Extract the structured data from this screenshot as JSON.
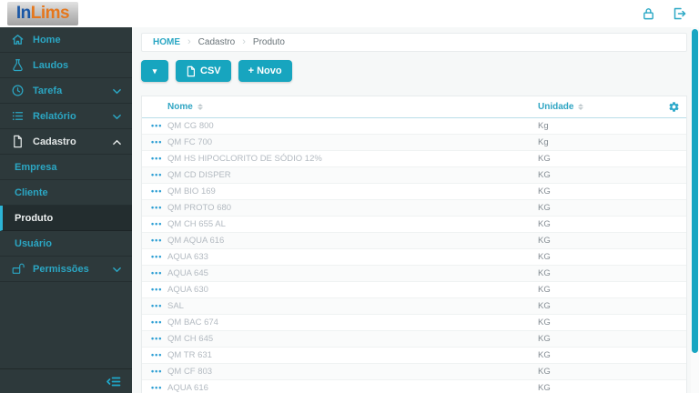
{
  "logo": {
    "part1": "In",
    "part2": "Lims"
  },
  "topbar": {
    "icons": [
      {
        "name": "lock-icon"
      },
      {
        "name": "logout-icon"
      }
    ]
  },
  "sidebar": {
    "items": [
      {
        "label": "Home",
        "icon": "home-icon"
      },
      {
        "label": "Laudos",
        "icon": "flask-icon"
      },
      {
        "label": "Tarefa",
        "icon": "clock-icon",
        "chevron": "down"
      },
      {
        "label": "Relatório",
        "icon": "list-icon",
        "chevron": "down"
      },
      {
        "label": "Cadastro",
        "icon": "document-icon",
        "chevron": "up",
        "expanded": true
      },
      {
        "label": "Empresa",
        "submenu": true
      },
      {
        "label": "Cliente",
        "submenu": true
      },
      {
        "label": "Produto",
        "submenu": true,
        "active": true
      },
      {
        "label": "Usuário",
        "submenu": true
      },
      {
        "label": "Permissões",
        "icon": "unlock-icon",
        "chevron": "down"
      }
    ],
    "collapse_icon": "collapse-sidebar-icon"
  },
  "breadcrumb": {
    "items": [
      "HOME",
      "Cadastro",
      "Produto"
    ],
    "separator": "›"
  },
  "toolbar": {
    "dropdown_caret": "▾",
    "csv_label": "CSV",
    "novo_label": "+ Novo"
  },
  "table": {
    "columns": [
      {
        "label": "Nome"
      },
      {
        "label": "Unidade"
      }
    ],
    "action_dots": "•••",
    "rows": [
      {
        "nome": "QM CG 800",
        "unidade": "Kg"
      },
      {
        "nome": "QM FC 700",
        "unidade": "Kg"
      },
      {
        "nome": "QM HS HIPOCLORITO DE SÓDIO 12%",
        "unidade": "KG"
      },
      {
        "nome": "QM CD DISPER",
        "unidade": "KG"
      },
      {
        "nome": "QM BIO 169",
        "unidade": "KG"
      },
      {
        "nome": "QM PROTO 680",
        "unidade": "KG"
      },
      {
        "nome": "QM CH 655 AL",
        "unidade": "KG"
      },
      {
        "nome": "QM AQUA 616",
        "unidade": "KG"
      },
      {
        "nome": "AQUA 633",
        "unidade": "KG"
      },
      {
        "nome": "AQUA 645",
        "unidade": "KG"
      },
      {
        "nome": "AQUA 630",
        "unidade": "KG"
      },
      {
        "nome": "SAL",
        "unidade": "KG"
      },
      {
        "nome": "QM BAC 674",
        "unidade": "KG"
      },
      {
        "nome": "QM CH 645",
        "unidade": "KG"
      },
      {
        "nome": "QM TR 631",
        "unidade": "KG"
      },
      {
        "nome": "QM CF 803",
        "unidade": "KG"
      },
      {
        "nome": "AQUA 616",
        "unidade": "KG"
      }
    ]
  },
  "colors": {
    "accent_teal": "#17a5bf",
    "sidebar_bg": "#2d393b",
    "sidebar_link": "#2ba7c4",
    "logo_blue": "#1a57a5",
    "logo_orange": "#e5771d"
  }
}
